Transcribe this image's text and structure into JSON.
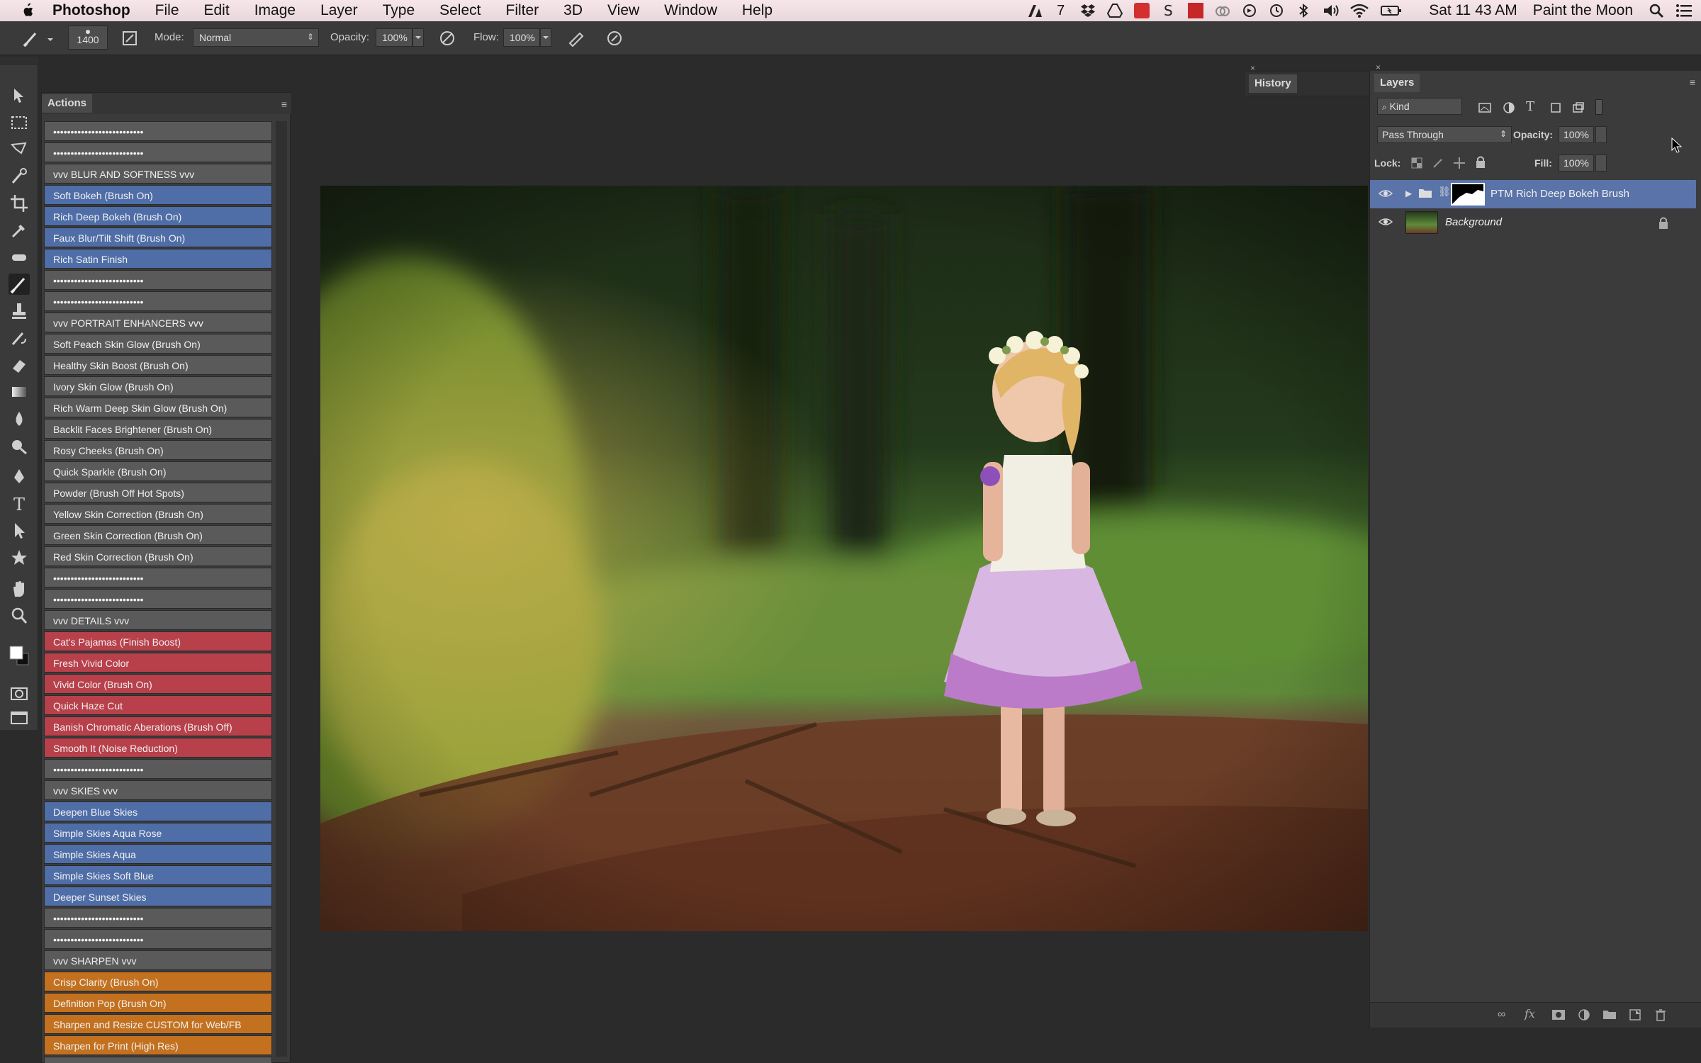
{
  "menubar": {
    "app_name": "Photoshop",
    "items": [
      "File",
      "Edit",
      "Image",
      "Layer",
      "Type",
      "Select",
      "Filter",
      "3D",
      "View",
      "Window",
      "Help"
    ],
    "adobe_tray": "7",
    "clock": "Sat 11 43 AM",
    "user": "Paint the Moon"
  },
  "options_bar": {
    "brush_size": "1400",
    "mode_label": "Mode:",
    "mode_value": "Normal",
    "opacity_label": "Opacity:",
    "opacity_value": "100%",
    "flow_label": "Flow:",
    "flow_value": "100%"
  },
  "actions_panel": {
    "title": "Actions",
    "items": [
      {
        "label": "••••••••••••••••••••••••••",
        "color": "gray"
      },
      {
        "label": "••••••••••••••••••••••••••",
        "color": "gray"
      },
      {
        "label": "vvv  BLUR AND SOFTNESS vvv",
        "color": "gray"
      },
      {
        "label": "Soft Bokeh (Brush On)",
        "color": "blue"
      },
      {
        "label": "Rich Deep Bokeh (Brush On)",
        "color": "blue"
      },
      {
        "label": "Faux Blur/Tilt Shift (Brush On)",
        "color": "blue"
      },
      {
        "label": "Rich Satin Finish",
        "color": "blue"
      },
      {
        "label": "••••••••••••••••••••••••••",
        "color": "gray"
      },
      {
        "label": "••••••••••••••••••••••••••",
        "color": "gray"
      },
      {
        "label": "vvv  PORTRAIT ENHANCERS vvv",
        "color": "gray"
      },
      {
        "label": "Soft Peach Skin Glow (Brush On)",
        "color": "gray"
      },
      {
        "label": "Healthy Skin Boost (Brush On)",
        "color": "gray"
      },
      {
        "label": "Ivory Skin Glow (Brush On)",
        "color": "gray"
      },
      {
        "label": "Rich Warm Deep Skin Glow (Brush On)",
        "color": "gray"
      },
      {
        "label": "Backlit Faces Brightener (Brush On)",
        "color": "gray"
      },
      {
        "label": "Rosy Cheeks (Brush On)",
        "color": "gray"
      },
      {
        "label": "Quick Sparkle (Brush On)",
        "color": "gray"
      },
      {
        "label": "Powder (Brush Off Hot Spots)",
        "color": "gray"
      },
      {
        "label": "Yellow Skin Correction (Brush On)",
        "color": "gray"
      },
      {
        "label": "Green Skin Correction (Brush On)",
        "color": "gray"
      },
      {
        "label": "Red Skin Correction (Brush On)",
        "color": "gray"
      },
      {
        "label": "••••••••••••••••••••••••••",
        "color": "gray"
      },
      {
        "label": "••••••••••••••••••••••••••",
        "color": "gray"
      },
      {
        "label": "vvv  DETAILS vvv",
        "color": "gray"
      },
      {
        "label": "Cat's Pajamas (Finish Boost)",
        "color": "red"
      },
      {
        "label": "Fresh Vivid Color",
        "color": "red"
      },
      {
        "label": "Vivid Color (Brush On)",
        "color": "red"
      },
      {
        "label": "Quick Haze Cut",
        "color": "red"
      },
      {
        "label": "Banish Chromatic Aberations (Brush Off)",
        "color": "red"
      },
      {
        "label": "Smooth It (Noise Reduction)",
        "color": "red"
      },
      {
        "label": "••••••••••••••••••••••••••",
        "color": "gray"
      },
      {
        "label": "vvv  SKIES  vvv",
        "color": "gray"
      },
      {
        "label": "Deepen Blue Skies",
        "color": "blue"
      },
      {
        "label": "Simple Skies Aqua Rose",
        "color": "blue"
      },
      {
        "label": "Simple Skies Aqua",
        "color": "blue"
      },
      {
        "label": "Simple Skies Soft Blue",
        "color": "blue"
      },
      {
        "label": "Deeper Sunset Skies",
        "color": "blue"
      },
      {
        "label": "••••••••••••••••••••••••••",
        "color": "gray"
      },
      {
        "label": "••••••••••••••••••••••••••",
        "color": "gray"
      },
      {
        "label": "vvv  SHARPEN vvv",
        "color": "gray"
      },
      {
        "label": "Crisp Clarity (Brush On)",
        "color": "orange"
      },
      {
        "label": "Definition Pop (Brush On)",
        "color": "orange"
      },
      {
        "label": "Sharpen and Resize CUSTOM for Web/FB",
        "color": "orange"
      },
      {
        "label": "Sharpen for Print (High Res)",
        "color": "orange"
      },
      {
        "label": "••••••••••••••••••••••••••",
        "color": "gray"
      }
    ]
  },
  "history_panel": {
    "title": "History"
  },
  "layers_panel": {
    "title": "Layers",
    "filter_value": "Kind",
    "blend_mode": "Pass Through",
    "opacity_label": "Opacity:",
    "opacity_value": "100%",
    "lock_label": "Lock:",
    "fill_label": "Fill:",
    "fill_value": "100%",
    "layers": [
      {
        "name": "PTM Rich Deep Bokeh Brush",
        "selected": true
      },
      {
        "name": "Background",
        "selected": false
      }
    ]
  },
  "colors": {
    "action_blue": "#4f6ea8",
    "action_red": "#b8404a",
    "action_orange": "#c4711f",
    "action_gray": "#5a5a5a",
    "layer_selected": "#5a73a8"
  }
}
